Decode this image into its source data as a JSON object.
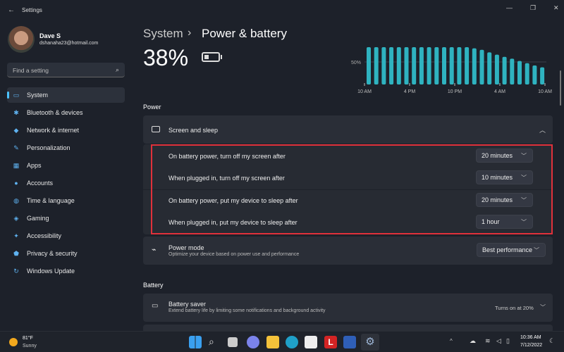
{
  "window": {
    "title": "Settings",
    "minimize": "—",
    "maximize": "❐",
    "close": "✕"
  },
  "user": {
    "name": "Dave S",
    "email": "dshanaha23@hotmail.com"
  },
  "search": {
    "placeholder": "Find a setting"
  },
  "sidebar": {
    "items": [
      {
        "label": "System",
        "icon": "monitor-icon",
        "glyph": "▭",
        "selected": true
      },
      {
        "label": "Bluetooth & devices",
        "icon": "bluetooth-icon",
        "glyph": "✱"
      },
      {
        "label": "Network & internet",
        "icon": "wifi-icon",
        "glyph": "◆"
      },
      {
        "label": "Personalization",
        "icon": "brush-icon",
        "glyph": "✎"
      },
      {
        "label": "Apps",
        "icon": "apps-icon",
        "glyph": "▦"
      },
      {
        "label": "Accounts",
        "icon": "person-icon",
        "glyph": "●"
      },
      {
        "label": "Time & language",
        "icon": "globe-icon",
        "glyph": "◍"
      },
      {
        "label": "Gaming",
        "icon": "gamepad-icon",
        "glyph": "◈"
      },
      {
        "label": "Accessibility",
        "icon": "accessibility-icon",
        "glyph": "✦"
      },
      {
        "label": "Privacy & security",
        "icon": "shield-icon",
        "glyph": "⬟"
      },
      {
        "label": "Windows Update",
        "icon": "update-icon",
        "glyph": "↻"
      }
    ]
  },
  "header": {
    "breadcrumb_parent": "System",
    "separator": "›",
    "title": "Power & battery",
    "battery_percent": "38%"
  },
  "chart_data": {
    "type": "bar",
    "categories": [
      "10 AM",
      "",
      "",
      "",
      "",
      "",
      "4 PM",
      "",
      "",
      "",
      "",
      "",
      "10 PM",
      "",
      "",
      "",
      "",
      "",
      "4 AM",
      "",
      "",
      "",
      "",
      "",
      "10 AM"
    ],
    "tick_labels": [
      "10 AM",
      "4 PM",
      "10 PM",
      "4 AM",
      "10 AM"
    ],
    "values": [
      100,
      100,
      100,
      100,
      100,
      100,
      100,
      100,
      100,
      100,
      100,
      100,
      100,
      100,
      97,
      93,
      86,
      80,
      74,
      69,
      63,
      57,
      51,
      46
    ],
    "gridline_label": "50%",
    "ylim": [
      0,
      100
    ],
    "bar_color": "#2fb3c0"
  },
  "power": {
    "section": "Power",
    "screen_sleep": {
      "title": "Screen and sleep",
      "rows": [
        {
          "label": "On battery power, turn off my screen after",
          "value": "20 minutes"
        },
        {
          "label": "When plugged in, turn off my screen after",
          "value": "10 minutes"
        },
        {
          "label": "On battery power, put my device to sleep after",
          "value": "20 minutes"
        },
        {
          "label": "When plugged in, put my device to sleep after",
          "value": "1 hour"
        }
      ]
    },
    "power_mode": {
      "title": "Power mode",
      "desc": "Optimize your device based on power use and performance",
      "value": "Best performance"
    }
  },
  "battery": {
    "section": "Battery",
    "saver": {
      "title": "Battery saver",
      "desc": "Extend battery life by limiting some notifications and background activity",
      "status": "Turns on at 20%"
    }
  },
  "highlight_color": "#e0313b",
  "taskbar": {
    "weather_temp": "81°F",
    "weather_desc": "Sunny",
    "time": "10:36 AM",
    "date": "7/12/2022"
  }
}
